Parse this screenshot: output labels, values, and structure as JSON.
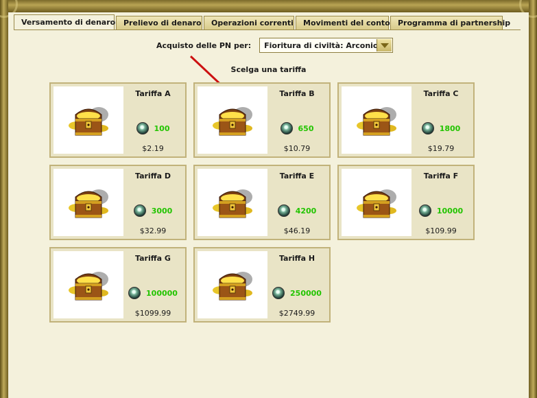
{
  "tabs": [
    {
      "label": "Versamento di denaro",
      "active": true
    },
    {
      "label": "Prelievo di denaro",
      "active": false
    },
    {
      "label": "Operazioni correnti",
      "active": false
    },
    {
      "label": "Movimenti del conto",
      "active": false
    },
    {
      "label": "Programma di partnership",
      "active": false
    }
  ],
  "selector": {
    "label": "Acquisto delle PN per:",
    "value": "Fioritura di civiltà: Arconio"
  },
  "subtitle": "Scelga una tariffa",
  "tariffs": [
    {
      "title": "Tariffa A",
      "points": "100",
      "price": "$2.19"
    },
    {
      "title": "Tariffa B",
      "points": "650",
      "price": "$10.79"
    },
    {
      "title": "Tariffa C",
      "points": "1800",
      "price": "$19.79"
    },
    {
      "title": "Tariffa D",
      "points": "3000",
      "price": "$32.99"
    },
    {
      "title": "Tariffa E",
      "points": "4200",
      "price": "$46.19"
    },
    {
      "title": "Tariffa F",
      "points": "10000",
      "price": "$109.99"
    },
    {
      "title": "Tariffa G",
      "points": "100000",
      "price": "$1099.99"
    },
    {
      "title": "Tariffa H",
      "points": "250000",
      "price": "$2749.99"
    }
  ],
  "colors": {
    "points_text": "#22c400",
    "annotation_arrow": "#cc1111",
    "frame_gold": "#b9a454"
  },
  "icons": {
    "card_image": "treasure-chest-icon",
    "points_gem": "gem-icon",
    "dropdown": "chevron-down-icon"
  }
}
